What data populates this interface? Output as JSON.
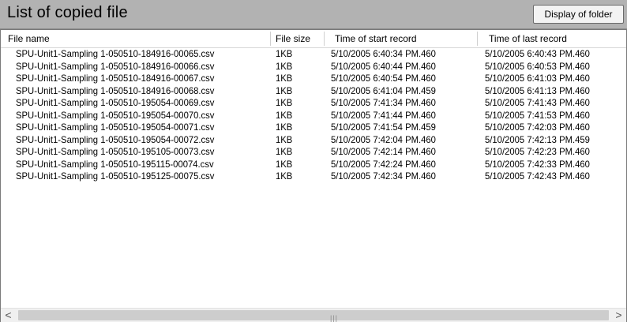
{
  "title": "List of copied file",
  "buttons": {
    "display_folder": "Display of folder"
  },
  "columns": [
    "File name",
    "File size",
    "Time of start record",
    "Time of last record"
  ],
  "rows": [
    [
      "SPU-Unit1-Sampling 1-050510-184916-00065.csv",
      "1KB",
      "5/10/2005 6:40:34 PM.460",
      "5/10/2005 6:40:43 PM.460"
    ],
    [
      "SPU-Unit1-Sampling 1-050510-184916-00066.csv",
      "1KB",
      "5/10/2005 6:40:44 PM.460",
      "5/10/2005 6:40:53 PM.460"
    ],
    [
      "SPU-Unit1-Sampling 1-050510-184916-00067.csv",
      "1KB",
      "5/10/2005 6:40:54 PM.460",
      "5/10/2005 6:41:03 PM.460"
    ],
    [
      "SPU-Unit1-Sampling 1-050510-184916-00068.csv",
      "1KB",
      "5/10/2005 6:41:04 PM.459",
      "5/10/2005 6:41:13 PM.460"
    ],
    [
      "SPU-Unit1-Sampling 1-050510-195054-00069.csv",
      "1KB",
      "5/10/2005 7:41:34 PM.460",
      "5/10/2005 7:41:43 PM.460"
    ],
    [
      "SPU-Unit1-Sampling 1-050510-195054-00070.csv",
      "1KB",
      "5/10/2005 7:41:44 PM.460",
      "5/10/2005 7:41:53 PM.460"
    ],
    [
      "SPU-Unit1-Sampling 1-050510-195054-00071.csv",
      "1KB",
      "5/10/2005 7:41:54 PM.459",
      "5/10/2005 7:42:03 PM.460"
    ],
    [
      "SPU-Unit1-Sampling 1-050510-195054-00072.csv",
      "1KB",
      "5/10/2005 7:42:04 PM.460",
      "5/10/2005 7:42:13 PM.459"
    ],
    [
      "SPU-Unit1-Sampling 1-050510-195105-00073.csv",
      "1KB",
      "5/10/2005 7:42:14 PM.460",
      "5/10/2005 7:42:23 PM.460"
    ],
    [
      "SPU-Unit1-Sampling 1-050510-195115-00074.csv",
      "1KB",
      "5/10/2005 7:42:24 PM.460",
      "5/10/2005 7:42:33 PM.460"
    ],
    [
      "SPU-Unit1-Sampling 1-050510-195125-00075.csv",
      "1KB",
      "5/10/2005 7:42:34 PM.460",
      "5/10/2005 7:42:43 PM.460"
    ]
  ],
  "scrollbar": {
    "left_arrow": "<",
    "right_arrow": ">",
    "grip": "|||"
  },
  "colors": {
    "title_bar": "#b2b2b2",
    "list_background": "#ffffff",
    "scrollbar": "#f0f0f0"
  }
}
